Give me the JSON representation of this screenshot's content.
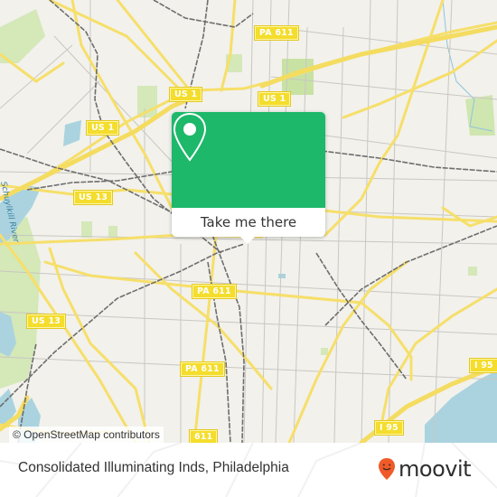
{
  "map": {
    "road_shields": [
      {
        "id": "pa611-top",
        "label": "PA 611"
      },
      {
        "id": "us1-left",
        "label": "US 1"
      },
      {
        "id": "us1-mid",
        "label": "US 1"
      },
      {
        "id": "us1-far-left",
        "label": "US 1"
      },
      {
        "id": "us13-mid",
        "label": "US 13"
      },
      {
        "id": "us13-low",
        "label": "US 13"
      },
      {
        "id": "pa611-mid",
        "label": "PA 611"
      },
      {
        "id": "pa611-low",
        "label": "PA 611"
      },
      {
        "id": "pa611-bottom",
        "label": "611"
      },
      {
        "id": "i95-right",
        "label": "I 95"
      },
      {
        "id": "i95-bottom",
        "label": "I 95"
      }
    ],
    "river_label": "Schuylkill River",
    "colors": {
      "background": "#f2f1ec",
      "major_road": "#f4dd6c",
      "minor_road": "#c8c6c0",
      "rail": "#6e6e6e",
      "water": "#aad3df",
      "park": "#cfe6b0"
    }
  },
  "popup": {
    "icon": "location-pin-icon",
    "button_label": "Take me there",
    "color": "#1db86a"
  },
  "attribution": "© OpenStreetMap contributors",
  "footer": {
    "place_name": "Consolidated Illuminating Inds, Philadelphia",
    "brand": "moovit",
    "brand_color": "#f05a28"
  }
}
